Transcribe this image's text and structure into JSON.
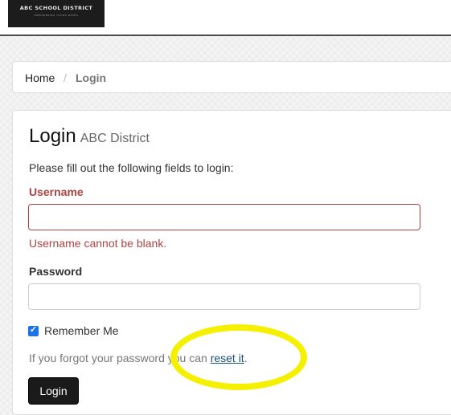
{
  "header": {
    "logo": {
      "name": "ABC SCHOOL DISTRICT",
      "tagline": "EMPOWERING YOUNG MINDS"
    }
  },
  "breadcrumb": {
    "items": [
      {
        "label": "Home"
      },
      {
        "label": "Login"
      }
    ],
    "separator": "/"
  },
  "login": {
    "title": "Login",
    "subtitle": "ABC District",
    "intro": "Please fill out the following fields to login:",
    "username": {
      "label": "Username",
      "value": "",
      "error": "Username cannot be blank."
    },
    "password": {
      "label": "Password",
      "value": ""
    },
    "remember_me": {
      "label": "Remember Me",
      "checked": true
    },
    "forgot": {
      "text": "If you forgot your password you can",
      "link_text": "reset it",
      "suffix": "."
    },
    "submit_label": "Login"
  },
  "annotation": {
    "color": "#f5f000"
  },
  "colors": {
    "error": "#a94442",
    "link": "#1a4f7a",
    "button_bg": "#1a1a1a",
    "checkbox": "#1a73e8"
  }
}
